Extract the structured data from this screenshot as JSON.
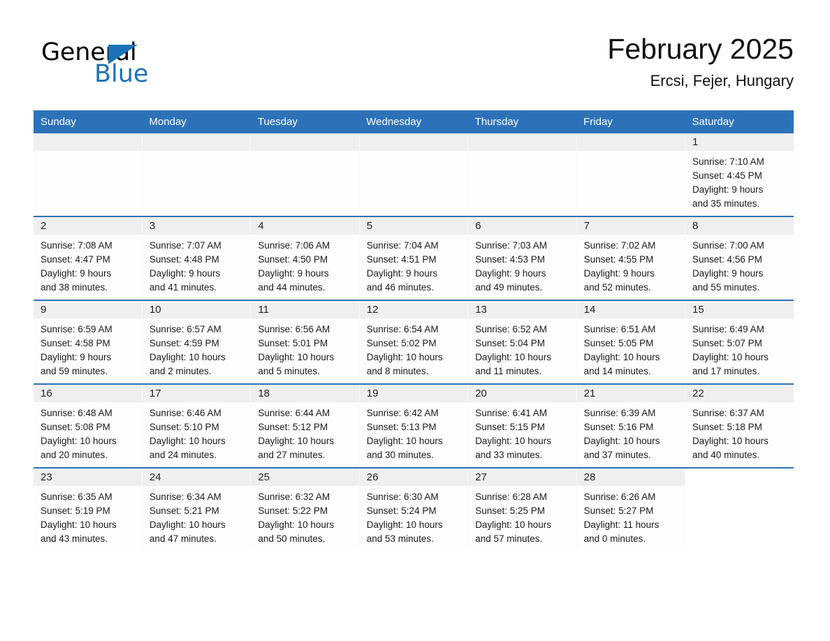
{
  "brand": {
    "name_part1": "General",
    "name_part2": "Blue",
    "triangle_color": "#1b72b8"
  },
  "header": {
    "title": "February 2025",
    "subtitle": "Ercsi, Fejer, Hungary"
  },
  "theme": {
    "header_blue": "#2d72b8",
    "daynum_gray": "#efefef",
    "cell_white": "#fdfdfd"
  },
  "weekdays": [
    "Sunday",
    "Monday",
    "Tuesday",
    "Wednesday",
    "Thursday",
    "Friday",
    "Saturday"
  ],
  "weeks": [
    [
      {
        "day": "",
        "empty": true
      },
      {
        "day": "",
        "empty": true
      },
      {
        "day": "",
        "empty": true
      },
      {
        "day": "",
        "empty": true
      },
      {
        "day": "",
        "empty": true
      },
      {
        "day": "",
        "empty": true
      },
      {
        "day": "1",
        "sunrise": "Sunrise: 7:10 AM",
        "sunset": "Sunset: 4:45 PM",
        "daylight1": "Daylight: 9 hours",
        "daylight2": "and 35 minutes."
      }
    ],
    [
      {
        "day": "2",
        "sunrise": "Sunrise: 7:08 AM",
        "sunset": "Sunset: 4:47 PM",
        "daylight1": "Daylight: 9 hours",
        "daylight2": "and 38 minutes."
      },
      {
        "day": "3",
        "sunrise": "Sunrise: 7:07 AM",
        "sunset": "Sunset: 4:48 PM",
        "daylight1": "Daylight: 9 hours",
        "daylight2": "and 41 minutes."
      },
      {
        "day": "4",
        "sunrise": "Sunrise: 7:06 AM",
        "sunset": "Sunset: 4:50 PM",
        "daylight1": "Daylight: 9 hours",
        "daylight2": "and 44 minutes."
      },
      {
        "day": "5",
        "sunrise": "Sunrise: 7:04 AM",
        "sunset": "Sunset: 4:51 PM",
        "daylight1": "Daylight: 9 hours",
        "daylight2": "and 46 minutes."
      },
      {
        "day": "6",
        "sunrise": "Sunrise: 7:03 AM",
        "sunset": "Sunset: 4:53 PM",
        "daylight1": "Daylight: 9 hours",
        "daylight2": "and 49 minutes."
      },
      {
        "day": "7",
        "sunrise": "Sunrise: 7:02 AM",
        "sunset": "Sunset: 4:55 PM",
        "daylight1": "Daylight: 9 hours",
        "daylight2": "and 52 minutes."
      },
      {
        "day": "8",
        "sunrise": "Sunrise: 7:00 AM",
        "sunset": "Sunset: 4:56 PM",
        "daylight1": "Daylight: 9 hours",
        "daylight2": "and 55 minutes."
      }
    ],
    [
      {
        "day": "9",
        "sunrise": "Sunrise: 6:59 AM",
        "sunset": "Sunset: 4:58 PM",
        "daylight1": "Daylight: 9 hours",
        "daylight2": "and 59 minutes."
      },
      {
        "day": "10",
        "sunrise": "Sunrise: 6:57 AM",
        "sunset": "Sunset: 4:59 PM",
        "daylight1": "Daylight: 10 hours",
        "daylight2": "and 2 minutes."
      },
      {
        "day": "11",
        "sunrise": "Sunrise: 6:56 AM",
        "sunset": "Sunset: 5:01 PM",
        "daylight1": "Daylight: 10 hours",
        "daylight2": "and 5 minutes."
      },
      {
        "day": "12",
        "sunrise": "Sunrise: 6:54 AM",
        "sunset": "Sunset: 5:02 PM",
        "daylight1": "Daylight: 10 hours",
        "daylight2": "and 8 minutes."
      },
      {
        "day": "13",
        "sunrise": "Sunrise: 6:52 AM",
        "sunset": "Sunset: 5:04 PM",
        "daylight1": "Daylight: 10 hours",
        "daylight2": "and 11 minutes."
      },
      {
        "day": "14",
        "sunrise": "Sunrise: 6:51 AM",
        "sunset": "Sunset: 5:05 PM",
        "daylight1": "Daylight: 10 hours",
        "daylight2": "and 14 minutes."
      },
      {
        "day": "15",
        "sunrise": "Sunrise: 6:49 AM",
        "sunset": "Sunset: 5:07 PM",
        "daylight1": "Daylight: 10 hours",
        "daylight2": "and 17 minutes."
      }
    ],
    [
      {
        "day": "16",
        "sunrise": "Sunrise: 6:48 AM",
        "sunset": "Sunset: 5:08 PM",
        "daylight1": "Daylight: 10 hours",
        "daylight2": "and 20 minutes."
      },
      {
        "day": "17",
        "sunrise": "Sunrise: 6:46 AM",
        "sunset": "Sunset: 5:10 PM",
        "daylight1": "Daylight: 10 hours",
        "daylight2": "and 24 minutes."
      },
      {
        "day": "18",
        "sunrise": "Sunrise: 6:44 AM",
        "sunset": "Sunset: 5:12 PM",
        "daylight1": "Daylight: 10 hours",
        "daylight2": "and 27 minutes."
      },
      {
        "day": "19",
        "sunrise": "Sunrise: 6:42 AM",
        "sunset": "Sunset: 5:13 PM",
        "daylight1": "Daylight: 10 hours",
        "daylight2": "and 30 minutes."
      },
      {
        "day": "20",
        "sunrise": "Sunrise: 6:41 AM",
        "sunset": "Sunset: 5:15 PM",
        "daylight1": "Daylight: 10 hours",
        "daylight2": "and 33 minutes."
      },
      {
        "day": "21",
        "sunrise": "Sunrise: 6:39 AM",
        "sunset": "Sunset: 5:16 PM",
        "daylight1": "Daylight: 10 hours",
        "daylight2": "and 37 minutes."
      },
      {
        "day": "22",
        "sunrise": "Sunrise: 6:37 AM",
        "sunset": "Sunset: 5:18 PM",
        "daylight1": "Daylight: 10 hours",
        "daylight2": "and 40 minutes."
      }
    ],
    [
      {
        "day": "23",
        "sunrise": "Sunrise: 6:35 AM",
        "sunset": "Sunset: 5:19 PM",
        "daylight1": "Daylight: 10 hours",
        "daylight2": "and 43 minutes."
      },
      {
        "day": "24",
        "sunrise": "Sunrise: 6:34 AM",
        "sunset": "Sunset: 5:21 PM",
        "daylight1": "Daylight: 10 hours",
        "daylight2": "and 47 minutes."
      },
      {
        "day": "25",
        "sunrise": "Sunrise: 6:32 AM",
        "sunset": "Sunset: 5:22 PM",
        "daylight1": "Daylight: 10 hours",
        "daylight2": "and 50 minutes."
      },
      {
        "day": "26",
        "sunrise": "Sunrise: 6:30 AM",
        "sunset": "Sunset: 5:24 PM",
        "daylight1": "Daylight: 10 hours",
        "daylight2": "and 53 minutes."
      },
      {
        "day": "27",
        "sunrise": "Sunrise: 6:28 AM",
        "sunset": "Sunset: 5:25 PM",
        "daylight1": "Daylight: 10 hours",
        "daylight2": "and 57 minutes."
      },
      {
        "day": "28",
        "sunrise": "Sunrise: 6:26 AM",
        "sunset": "Sunset: 5:27 PM",
        "daylight1": "Daylight: 11 hours",
        "daylight2": "and 0 minutes."
      },
      {
        "day": "",
        "empty": true,
        "blank": true
      }
    ]
  ]
}
